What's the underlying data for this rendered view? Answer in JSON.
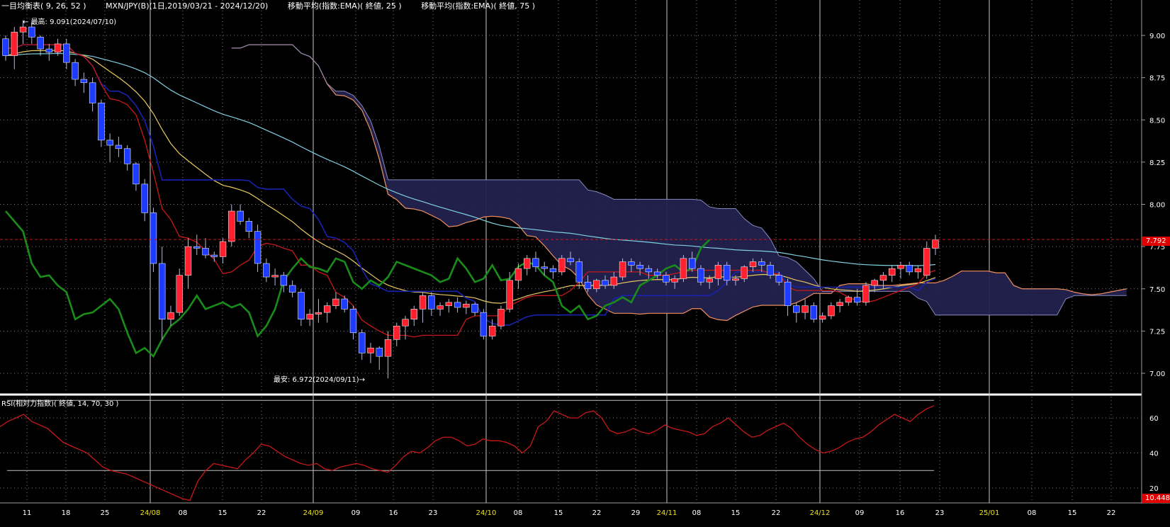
{
  "header": {
    "main_indicator": "一目均衡表( 9, 26, 52 )",
    "instrument": "MXN/JPY(B)(1日,2019/03/21 - 2024/12/20)",
    "ema1": "移動平均(指数:EMA)( 終値, 25 )",
    "ema2": "移動平均(指数:EMA)( 終値, 75 )"
  },
  "rsi_header": "RSI(相対力指数)( 終値, 14, 70, 30 )",
  "annotations": {
    "high": "← 最高: 9.091(2024/07/10)",
    "low": "最安: 6.972(2024/09/11)→"
  },
  "last_price_label": "7.792",
  "rsi_bottom_label": "10.448",
  "colors": {
    "background": "#000000",
    "grid": "#7a7a7a",
    "bull_candle": "#ff1f2d",
    "bear_candle": "#1e3cff",
    "cloud_fill": "#22224e",
    "cloud_fill_bear": "#2a1208",
    "span_a": "#f09060",
    "span_b": "#8888c0",
    "tenkan": "#c81818",
    "kijun": "#1a22b0",
    "chikou": "#1a8c1a",
    "ema25": "#e8c860",
    "ema75": "#80d0e0",
    "rsi_line": "#c81818",
    "price_line": "#c81818",
    "axis_date_month": "#f0e020"
  },
  "chart_data": [
    {
      "type": "candlestick",
      "title": "一目均衡表( 9, 26, 52 )",
      "price_range": [
        6.9,
        9.2
      ],
      "y_ticks": [
        "9.00",
        "8.75",
        "8.50",
        "8.25",
        "8.00",
        "7.75",
        "7.50",
        "7.25",
        "7.00"
      ],
      "x_tick_labels": [
        "11",
        "18",
        "25",
        "24/08",
        "08",
        "15",
        "22",
        "24/09",
        "09",
        "16",
        "23",
        "24/10",
        "08",
        "15",
        "22",
        "29",
        "24/11",
        "08",
        "15",
        "22",
        "24/12",
        "09",
        "16",
        "23",
        "25/01",
        "08",
        "15",
        "22"
      ],
      "current_price": 7.792,
      "grid": true,
      "candles": [
        [
          8.98,
          9.0,
          8.85,
          8.88
        ],
        [
          8.88,
          9.05,
          8.8,
          9.02
        ],
        [
          9.02,
          9.09,
          8.95,
          9.05
        ],
        [
          9.05,
          9.08,
          8.95,
          8.99
        ],
        [
          8.99,
          9.0,
          8.88,
          8.92
        ],
        [
          8.92,
          8.95,
          8.85,
          8.9
        ],
        [
          8.9,
          8.98,
          8.88,
          8.95
        ],
        [
          8.95,
          8.98,
          8.8,
          8.84
        ],
        [
          8.84,
          8.86,
          8.7,
          8.74
        ],
        [
          8.74,
          8.78,
          8.66,
          8.72
        ],
        [
          8.72,
          8.75,
          8.55,
          8.6
        ],
        [
          8.6,
          8.62,
          8.34,
          8.38
        ],
        [
          8.38,
          8.42,
          8.25,
          8.35
        ],
        [
          8.35,
          8.4,
          8.28,
          8.33
        ],
        [
          8.33,
          8.35,
          8.2,
          8.24
        ],
        [
          8.24,
          8.25,
          8.08,
          8.12
        ],
        [
          8.12,
          8.15,
          7.9,
          7.95
        ],
        [
          7.95,
          7.98,
          7.6,
          7.65
        ],
        [
          7.65,
          7.75,
          7.2,
          7.32
        ],
        [
          7.32,
          7.4,
          7.28,
          7.36
        ],
        [
          7.36,
          7.62,
          7.34,
          7.58
        ],
        [
          7.58,
          7.8,
          7.5,
          7.75
        ],
        [
          7.75,
          7.82,
          7.7,
          7.74
        ],
        [
          7.74,
          7.8,
          7.68,
          7.7
        ],
        [
          7.7,
          7.72,
          7.66,
          7.69
        ],
        [
          7.69,
          7.8,
          7.65,
          7.78
        ],
        [
          7.78,
          8.0,
          7.75,
          7.96
        ],
        [
          7.96,
          8.0,
          7.88,
          7.9
        ],
        [
          7.9,
          7.92,
          7.8,
          7.84
        ],
        [
          7.84,
          7.88,
          7.6,
          7.65
        ],
        [
          7.65,
          7.68,
          7.54,
          7.57
        ],
        [
          7.57,
          7.62,
          7.52,
          7.58
        ],
        [
          7.58,
          7.6,
          7.48,
          7.52
        ],
        [
          7.52,
          7.55,
          7.45,
          7.48
        ],
        [
          7.48,
          7.5,
          7.28,
          7.32
        ],
        [
          7.32,
          7.38,
          7.28,
          7.35
        ],
        [
          7.35,
          7.44,
          7.3,
          7.36
        ],
        [
          7.36,
          7.42,
          7.3,
          7.4
        ],
        [
          7.4,
          7.48,
          7.38,
          7.44
        ],
        [
          7.44,
          7.46,
          7.36,
          7.38
        ],
        [
          7.38,
          7.4,
          7.2,
          7.24
        ],
        [
          7.24,
          7.26,
          7.08,
          7.12
        ],
        [
          7.12,
          7.18,
          7.06,
          7.15
        ],
        [
          7.15,
          7.16,
          7.02,
          7.1
        ],
        [
          7.1,
          7.25,
          6.97,
          7.2
        ],
        [
          7.2,
          7.3,
          7.16,
          7.28
        ],
        [
          7.28,
          7.34,
          7.2,
          7.32
        ],
        [
          7.32,
          7.4,
          7.28,
          7.38
        ],
        [
          7.38,
          7.48,
          7.3,
          7.46
        ],
        [
          7.46,
          7.48,
          7.34,
          7.38
        ],
        [
          7.38,
          7.42,
          7.34,
          7.4
        ],
        [
          7.4,
          7.44,
          7.36,
          7.42
        ],
        [
          7.42,
          7.45,
          7.36,
          7.39
        ],
        [
          7.39,
          7.43,
          7.35,
          7.41
        ],
        [
          7.41,
          7.42,
          7.34,
          7.36
        ],
        [
          7.36,
          7.38,
          7.2,
          7.22
        ],
        [
          7.22,
          7.32,
          7.2,
          7.28
        ],
        [
          7.28,
          7.4,
          7.26,
          7.38
        ],
        [
          7.38,
          7.6,
          7.36,
          7.55
        ],
        [
          7.55,
          7.65,
          7.5,
          7.62
        ],
        [
          7.62,
          7.7,
          7.58,
          7.68
        ],
        [
          7.68,
          7.72,
          7.6,
          7.63
        ],
        [
          7.63,
          7.66,
          7.58,
          7.62
        ],
        [
          7.62,
          7.64,
          7.56,
          7.6
        ],
        [
          7.6,
          7.7,
          7.58,
          7.68
        ],
        [
          7.68,
          7.72,
          7.64,
          7.66
        ],
        [
          7.66,
          7.68,
          7.5,
          7.54
        ],
        [
          7.54,
          7.58,
          7.48,
          7.5
        ],
        [
          7.5,
          7.56,
          7.48,
          7.55
        ],
        [
          7.55,
          7.58,
          7.5,
          7.52
        ],
        [
          7.52,
          7.6,
          7.5,
          7.57
        ],
        [
          7.57,
          7.68,
          7.55,
          7.66
        ],
        [
          7.66,
          7.68,
          7.6,
          7.64
        ],
        [
          7.64,
          7.66,
          7.58,
          7.62
        ],
        [
          7.62,
          7.64,
          7.56,
          7.6
        ],
        [
          7.6,
          7.62,
          7.56,
          7.58
        ],
        [
          7.58,
          7.6,
          7.52,
          7.54
        ],
        [
          7.54,
          7.58,
          7.5,
          7.56
        ],
        [
          7.56,
          7.7,
          7.54,
          7.68
        ],
        [
          7.68,
          7.72,
          7.6,
          7.62
        ],
        [
          7.62,
          7.64,
          7.52,
          7.54
        ],
        [
          7.54,
          7.58,
          7.5,
          7.56
        ],
        [
          7.56,
          7.66,
          7.52,
          7.64
        ],
        [
          7.64,
          7.66,
          7.52,
          7.55
        ],
        [
          7.55,
          7.58,
          7.52,
          7.56
        ],
        [
          7.56,
          7.64,
          7.54,
          7.63
        ],
        [
          7.63,
          7.68,
          7.6,
          7.66
        ],
        [
          7.66,
          7.68,
          7.6,
          7.64
        ],
        [
          7.64,
          7.66,
          7.56,
          7.58
        ],
        [
          7.58,
          7.6,
          7.52,
          7.54
        ],
        [
          7.54,
          7.56,
          7.34,
          7.4
        ],
        [
          7.4,
          7.42,
          7.3,
          7.36
        ],
        [
          7.36,
          7.44,
          7.32,
          7.4
        ],
        [
          7.4,
          7.42,
          7.3,
          7.32
        ],
        [
          7.32,
          7.36,
          7.3,
          7.34
        ],
        [
          7.34,
          7.42,
          7.32,
          7.4
        ],
        [
          7.4,
          7.44,
          7.36,
          7.42
        ],
        [
          7.42,
          7.46,
          7.4,
          7.45
        ],
        [
          7.45,
          7.5,
          7.4,
          7.42
        ],
        [
          7.42,
          7.54,
          7.4,
          7.52
        ],
        [
          7.52,
          7.56,
          7.48,
          7.55
        ],
        [
          7.55,
          7.6,
          7.5,
          7.58
        ],
        [
          7.58,
          7.64,
          7.54,
          7.62
        ],
        [
          7.62,
          7.66,
          7.56,
          7.64
        ],
        [
          7.64,
          7.66,
          7.58,
          7.6
        ],
        [
          7.6,
          7.64,
          7.56,
          7.62
        ],
        [
          7.58,
          7.78,
          7.56,
          7.74
        ],
        [
          7.74,
          7.82,
          7.7,
          7.79
        ]
      ],
      "series": [
        {
          "type": "line",
          "x_start": 0,
          "values": [
            8.9,
            8.92,
            8.93,
            8.93,
            8.92,
            8.9,
            8.86,
            8.78,
            8.68,
            8.6,
            8.5,
            8.4,
            8.3,
            8.2,
            8.1,
            8.0,
            7.9,
            7.84,
            7.8,
            7.78,
            7.76,
            7.75,
            7.74,
            7.72,
            7.7,
            7.68,
            7.66,
            7.64,
            7.62,
            7.6,
            7.58,
            7.57,
            7.55,
            7.53,
            7.51,
            7.49,
            7.47,
            7.45,
            7.43,
            7.41,
            7.4,
            7.4,
            7.41,
            7.42,
            7.44,
            7.46,
            7.47,
            7.48,
            7.5,
            7.51,
            7.52,
            7.53,
            7.54,
            7.55,
            7.56,
            7.57,
            7.58,
            7.58,
            7.59,
            7.6
          ]
        },
        {
          "type": "line",
          "x_start": 0,
          "values": [
            8.95,
            8.95,
            8.94,
            8.93,
            8.92,
            8.9,
            8.88,
            8.86,
            8.84,
            8.82,
            8.79,
            8.76,
            8.73,
            8.7,
            8.66,
            8.62,
            8.58,
            8.54,
            8.5,
            8.46,
            8.42,
            8.38,
            8.34,
            8.3,
            8.26,
            8.22,
            8.18,
            8.14,
            8.1,
            8.06,
            8.02,
            7.98,
            7.95,
            7.92,
            7.89,
            7.86,
            7.83,
            7.8,
            7.78,
            7.76,
            7.74,
            7.72,
            7.71,
            7.7,
            7.69,
            7.68,
            7.67,
            7.66,
            7.65,
            7.64,
            7.63,
            7.62,
            7.62,
            7.61,
            7.61,
            7.6,
            7.6,
            7.6,
            7.6,
            7.61
          ]
        }
      ]
    },
    {
      "type": "line",
      "title": "RSI(相対力指数)( 終値, 14, 70, 30 )",
      "y_range": [
        10,
        70
      ],
      "y_ticks": [
        20,
        40,
        60
      ],
      "reference_lines": [
        30,
        70
      ],
      "current_value": 10.448,
      "series": [
        {
          "values": [
            55,
            58,
            60,
            62,
            58,
            56,
            54,
            50,
            46,
            44,
            42,
            40,
            36,
            32,
            30,
            29,
            28,
            26,
            24,
            22,
            20,
            18,
            16,
            14,
            13,
            24,
            30,
            34,
            33,
            32,
            31,
            36,
            40,
            45,
            44,
            41,
            38,
            36,
            34,
            33,
            34,
            31,
            30,
            32,
            33,
            34,
            33,
            31,
            30,
            29,
            33,
            38,
            41,
            40,
            43,
            47,
            49,
            49,
            47,
            44,
            45,
            48,
            47,
            47,
            46,
            44,
            40,
            44,
            55,
            58,
            64,
            62,
            60,
            60,
            63,
            64,
            60,
            53,
            51,
            52,
            54,
            52,
            51,
            53,
            56,
            54,
            53,
            52,
            50,
            51,
            55,
            57,
            60,
            56,
            52,
            49,
            50,
            53,
            55,
            57,
            54,
            49,
            45,
            42,
            40,
            41,
            43,
            46,
            48,
            49,
            52,
            56,
            59,
            62,
            60,
            58,
            62,
            65,
            67
          ]
        }
      ]
    }
  ]
}
